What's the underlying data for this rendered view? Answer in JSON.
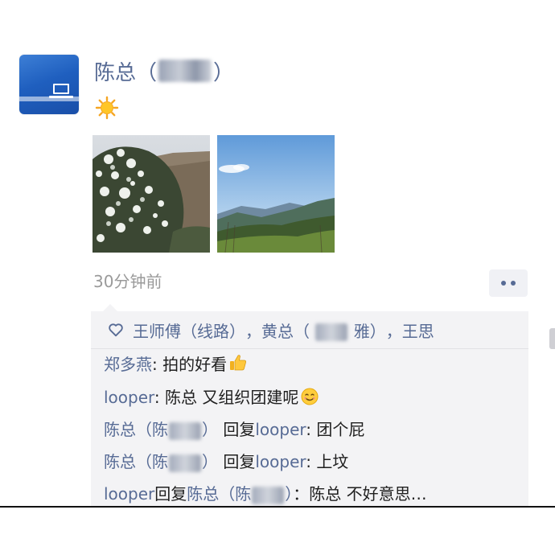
{
  "post": {
    "author_prefix": "陈总（",
    "author_suffix": "）",
    "time": "30分钟前",
    "emoji": "sun-icon",
    "photos": [
      "flowering-tree-photo",
      "mountain-sky-photo"
    ]
  },
  "likes": {
    "first": "王师傅（线路）",
    "sep1": "，",
    "second_prefix": "黄总（",
    "second_suffix": "雅）",
    "sep2": "，",
    "third": "王思"
  },
  "comments": [
    {
      "name": "郑多燕",
      "text": ": 拍的好看"
    },
    {
      "name": "looper",
      "text": ": 陈总 又组织团建呢"
    },
    {
      "name_prefix": "陈总（陈",
      "name_suffix": "）",
      "reply_word": "回复",
      "target": "looper",
      "text": ": 团个屁"
    },
    {
      "name_prefix": "陈总（陈",
      "name_suffix": "）",
      "reply_word": "回复",
      "target": "looper",
      "text": ": 上坟"
    },
    {
      "name": "looper",
      "reply_word": "回复",
      "target_prefix": "陈总（陈",
      "target_suffix": "）",
      "text": "：陈总 不好意思…"
    }
  ],
  "colors": {
    "link": "#576b95",
    "panel": "#f3f3f5",
    "time": "#9a9a9a"
  }
}
